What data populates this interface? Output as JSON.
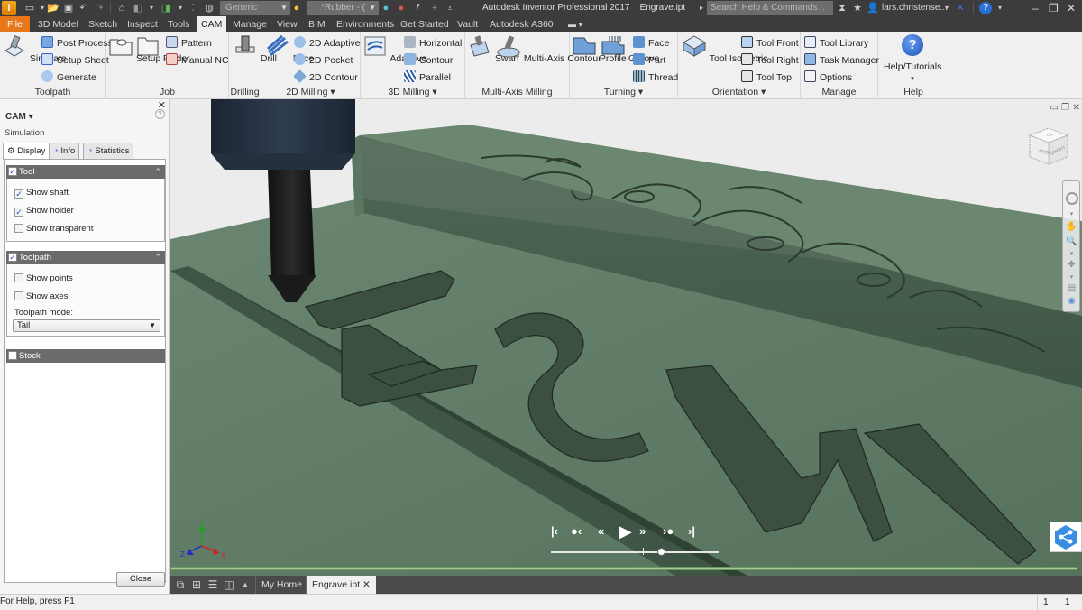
{
  "titlebar": {
    "app_logo": "I",
    "material_combo": "Generic",
    "appearance_combo": "*Rubber - (",
    "app_title": "Autodesk Inventor Professional 2017",
    "document_name": "Engrave.ipt",
    "search_placeholder": "Search Help & Commands...",
    "user_name": "lars.christense...",
    "window_controls": [
      "minimize",
      "restore",
      "close"
    ]
  },
  "ribbon_tabs": [
    {
      "label": "File",
      "state": "file"
    },
    {
      "label": "3D Model"
    },
    {
      "label": "Sketch"
    },
    {
      "label": "Inspect"
    },
    {
      "label": "Tools"
    },
    {
      "label": "CAM",
      "state": "active"
    },
    {
      "label": "Manage"
    },
    {
      "label": "View"
    },
    {
      "label": "BIM"
    },
    {
      "label": "Environments"
    },
    {
      "label": "Get Started"
    },
    {
      "label": "Vault"
    },
    {
      "label": "Autodesk A360"
    }
  ],
  "ribbon": {
    "toolpath": {
      "label": "Toolpath",
      "simulate": "Simulate",
      "post_process": "Post Process",
      "setup_sheet": "Setup Sheet",
      "generate": "Generate"
    },
    "job": {
      "label": "Job",
      "setup": "Setup",
      "folder": "Folder",
      "pattern": "Pattern",
      "manual_nc": "Manual NC"
    },
    "drilling": {
      "label": "Drilling",
      "drill": "Drill"
    },
    "milling2d": {
      "label": "2D Milling",
      "face": "Face",
      "adaptive": "2D Adaptive",
      "pocket": "2D Pocket",
      "contour": "2D Contour"
    },
    "milling3d": {
      "label": "3D Milling",
      "adaptive": "Adaptive",
      "horizontal": "Horizontal",
      "contour": "Contour",
      "parallel": "Parallel"
    },
    "multiaxis": {
      "label": "Multi-Axis Milling",
      "swarf": "Swarf",
      "contour": "Multi-Axis Contour"
    },
    "turning": {
      "label": "Turning",
      "profile": "Profile",
      "groove": "Groove",
      "face": "Face",
      "part": "Part",
      "thread": "Thread"
    },
    "orientation": {
      "label": "Orientation",
      "isometric": "Tool Isometric",
      "front": "Tool Front",
      "right": "Tool Right",
      "top": "Tool Top"
    },
    "manage": {
      "label": "Manage",
      "library": "Tool Library",
      "task_manager": "Task Manager",
      "options": "Options"
    },
    "help": {
      "label": "Help",
      "tutorials": "Help/Tutorials"
    }
  },
  "left_panel": {
    "title": "CAM",
    "subtitle": "Simulation",
    "tabs": [
      {
        "label": "Display",
        "active": true
      },
      {
        "label": "Info"
      },
      {
        "label": "Statistics"
      }
    ],
    "tool_section": {
      "title": "Tool",
      "checked": true,
      "options": [
        {
          "label": "Show shaft",
          "checked": true
        },
        {
          "label": "Show holder",
          "checked": true
        },
        {
          "label": "Show transparent",
          "checked": false
        }
      ]
    },
    "toolpath_section": {
      "title": "Toolpath",
      "checked": true,
      "options": [
        {
          "label": "Show points",
          "checked": false
        },
        {
          "label": "Show axes",
          "checked": false
        }
      ],
      "mode_label": "Toolpath mode:",
      "mode_value": "Tail"
    },
    "stock_section": {
      "title": "Stock",
      "checked": false
    },
    "close_label": "Close"
  },
  "viewport": {
    "engraved_text": "HSM",
    "viewcube_faces": [
      "FRONT",
      "RIGHT",
      "TOP"
    ],
    "axes": {
      "x": "X",
      "y": "Y",
      "z": "Z"
    },
    "simulation_position": 0.66,
    "colors": {
      "stock": "#5e7a64",
      "background": "#ececec",
      "axis_x": "#d42020",
      "axis_y": "#22a022",
      "axis_z": "#2030c0"
    }
  },
  "doc_tabs": [
    {
      "label": "My Home"
    },
    {
      "label": "Engrave.ipt",
      "active": true
    }
  ],
  "statusbar": {
    "help_text": "For Help, press F1",
    "cells": [
      "1",
      "1"
    ]
  }
}
